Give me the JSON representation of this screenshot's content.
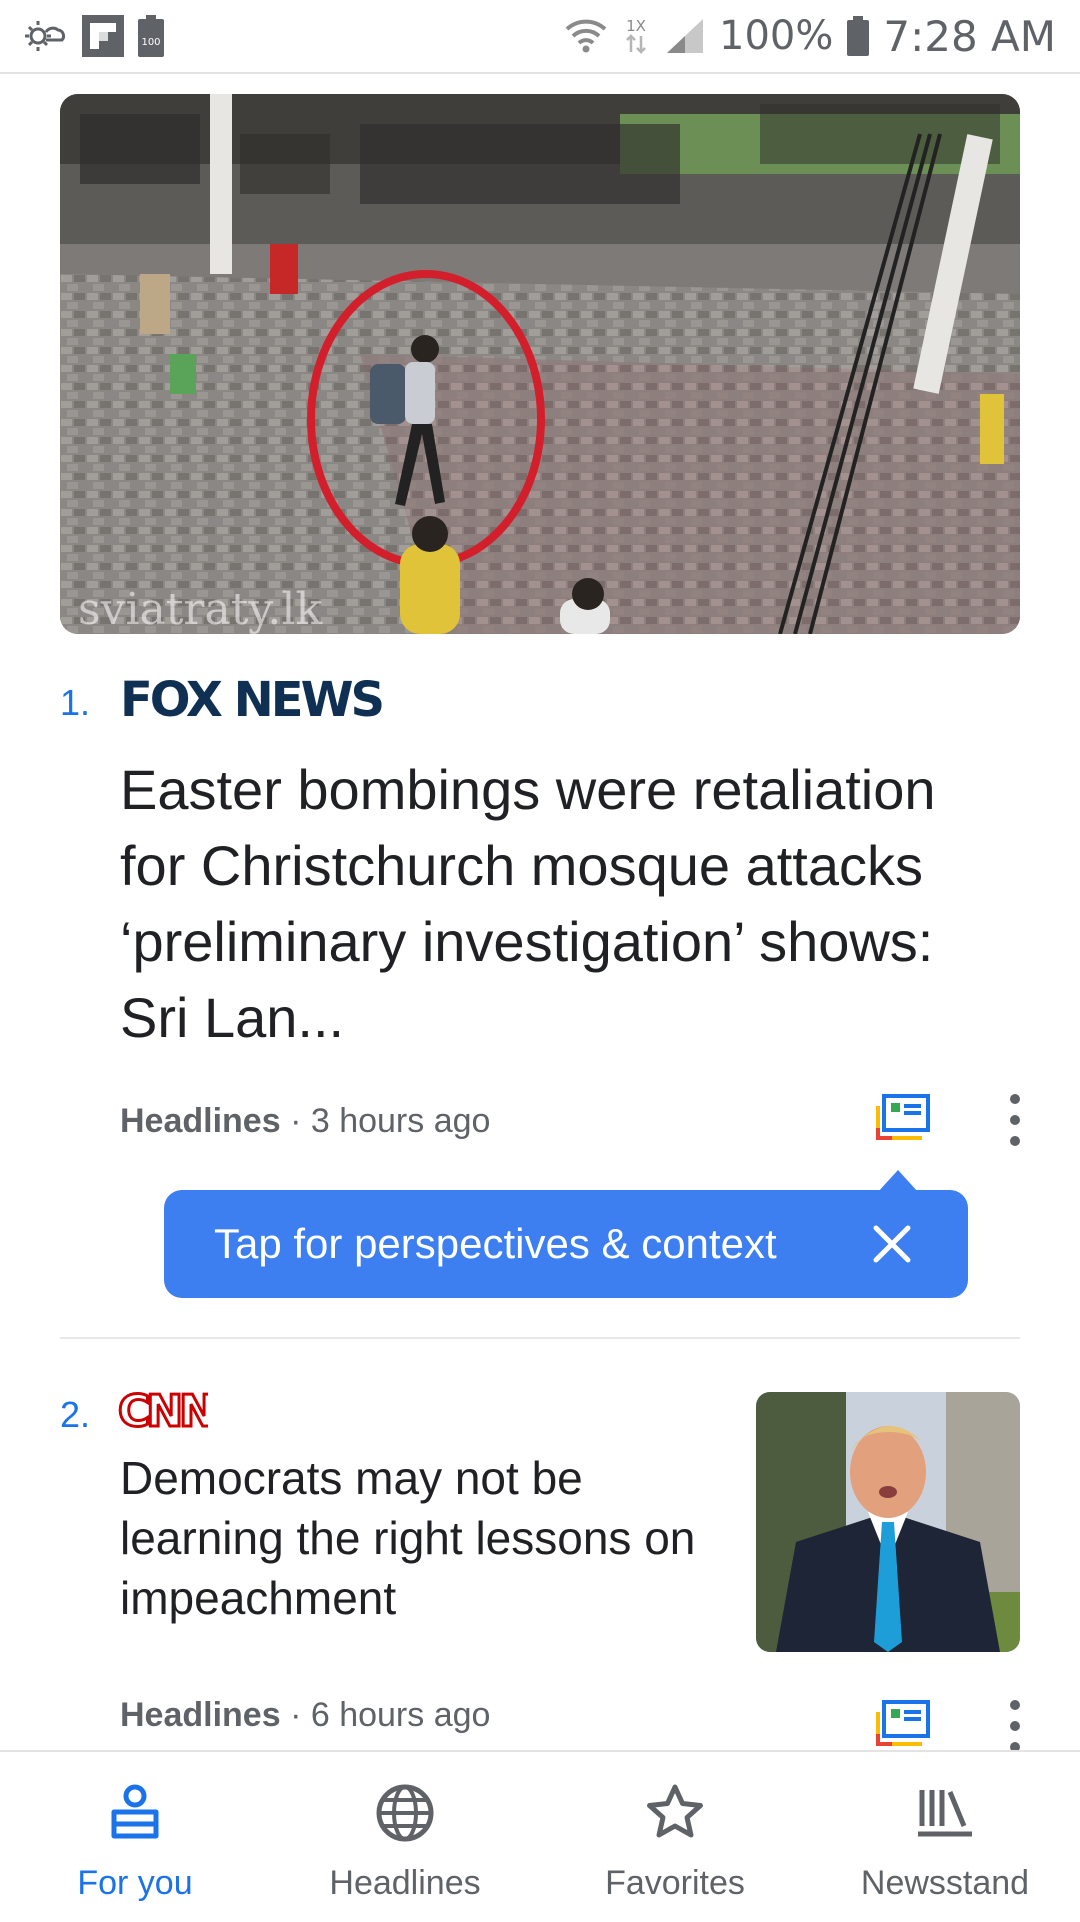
{
  "status_bar": {
    "battery_percent": "100%",
    "time": "7:28 AM",
    "icons": [
      "weather-icon",
      "flipboard-icon",
      "battery-saver-icon",
      "wifi-icon",
      "data-transfer-icon",
      "signal-icon",
      "battery-icon"
    ],
    "notif_battery_label": "100",
    "data_label": "1X"
  },
  "articles": [
    {
      "rank": "1.",
      "publisher": "FOX NEWS",
      "headline": "Easter bombings were retaliation for Christchurch mosque attacks ‘preliminary investigation’ shows: Sri Lan...",
      "section": "Headlines",
      "time_ago": "· 3 hours ago",
      "image_watermark": "sviatraty.lk"
    },
    {
      "rank": "2.",
      "publisher": "CNN",
      "headline": "Democrats may not be learning the right lessons on impeachment",
      "section": "Headlines",
      "time_ago": "· 6 hours ago"
    }
  ],
  "tooltip": {
    "text": "Tap for perspectives & context"
  },
  "bottom_nav": [
    {
      "label": "For you",
      "icon": "for-you-icon",
      "active": true
    },
    {
      "label": "Headlines",
      "icon": "globe-icon",
      "active": false
    },
    {
      "label": "Favorites",
      "icon": "star-icon",
      "active": false
    },
    {
      "label": "Newsstand",
      "icon": "newsstand-icon",
      "active": false
    }
  ],
  "colors": {
    "accent": "#1a73e8",
    "tooltip_bg": "#3d7ff0",
    "fox_navy": "#0f3052",
    "cnn_red": "#cc0000",
    "meta_gray": "#5f6368"
  }
}
